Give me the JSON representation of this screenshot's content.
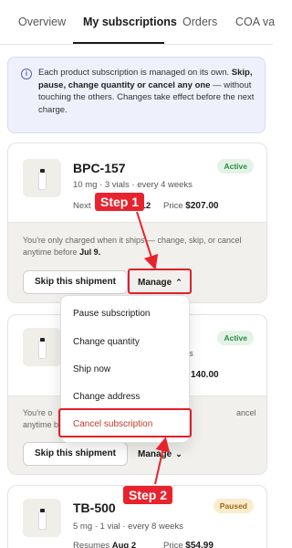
{
  "tabs": [
    {
      "label": "Overview"
    },
    {
      "label": "My subscriptions",
      "active": true
    },
    {
      "label": "Orders"
    },
    {
      "label": "COA va"
    }
  ],
  "notice": {
    "icon": "info-icon",
    "text_1": "Each product subscription is managed on its own.",
    "bold": "Skip, pause, change quantity or cancel any one",
    "text_2": " — without touching the others. Changes take effect before the next charge."
  },
  "cards": [
    {
      "name": "BPC-157",
      "meta": "10 mg · 3 vials · every 4 weeks",
      "next_label": "Next",
      "next_value": "12",
      "price_label": "Price",
      "price": "$207.00",
      "status": "Active",
      "footer_text": "You're only charged when it ships — change, skip, or cancel anytime before",
      "footer_date": "Jul 9.",
      "skip_label": "Skip this shipment",
      "manage_label": "Manage",
      "manage_chevron": "chevron-up-icon"
    },
    {
      "name": "",
      "meta": "s",
      "price": "140.00",
      "status": "Active",
      "footer_text_left": "You're o",
      "footer_text_left2": "anytime b",
      "footer_text_right": "ancel",
      "skip_label": "Skip this shipment",
      "manage_label": "Manage",
      "manage_chevron": "chevron-down-icon"
    },
    {
      "name": "TB-500",
      "meta": "5 mg · 1 vial · every 8 weeks",
      "next_label": "Resumes",
      "next_value": "Aug 2",
      "price_label": "Price",
      "price": "$54.99",
      "status": "Paused"
    }
  ],
  "manage_menu": [
    {
      "label": "Pause subscription"
    },
    {
      "label": "Change quantity"
    },
    {
      "label": "Ship now"
    },
    {
      "label": "Change address"
    },
    {
      "label": "Cancel subscription",
      "danger": true
    }
  ],
  "annotations": {
    "step1": "Step 1",
    "step2": "Step 2",
    "color": "#e8232d"
  }
}
